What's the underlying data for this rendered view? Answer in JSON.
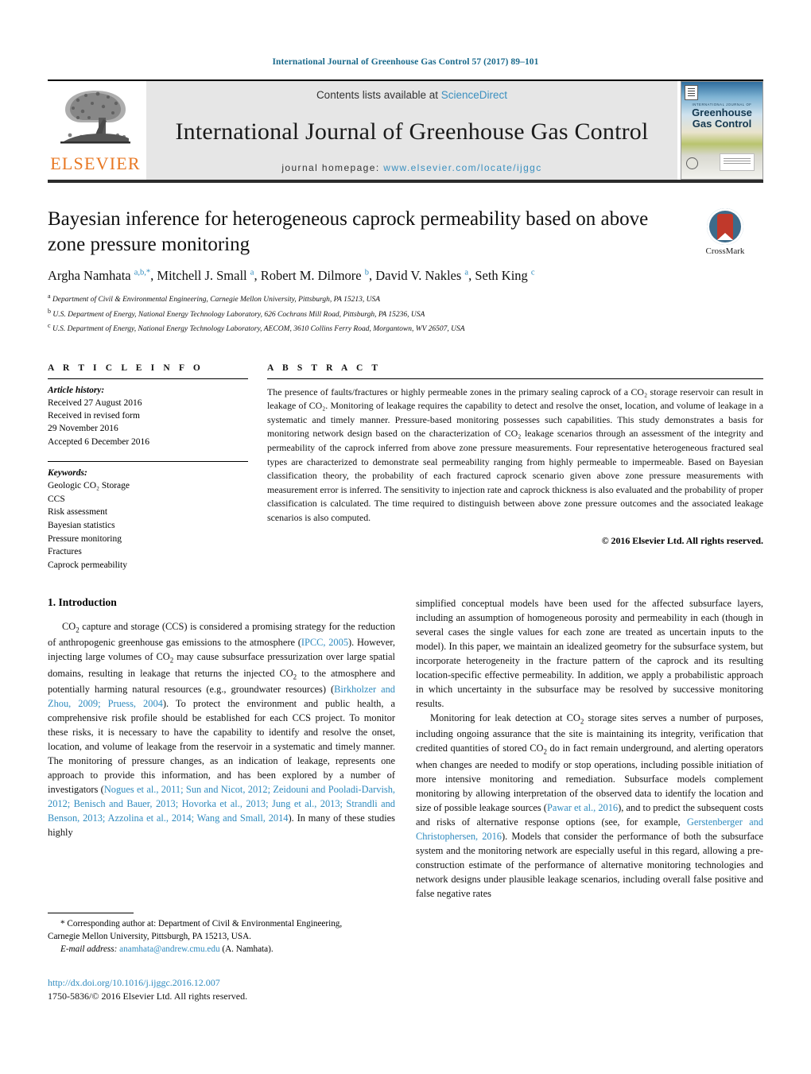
{
  "running_head": "International Journal of Greenhouse Gas Control 57 (2017) 89–101",
  "masthead": {
    "publisher": "ELSEVIER",
    "contents_prefix": "Contents lists available at ",
    "contents_link": "ScienceDirect",
    "journal_title": "International Journal of Greenhouse Gas Control",
    "homepage_prefix": "journal homepage:",
    "homepage_url": "www.elsevier.com/locate/ijggc",
    "cover": {
      "kicker": "INTERNATIONAL JOURNAL OF",
      "title_line1": "Greenhouse",
      "title_line2": "Gas Control"
    },
    "link_color": "#3a8fbf",
    "brand_color": "#E87722"
  },
  "article": {
    "title": "Bayesian inference for heterogeneous caprock permeability based on above zone pressure monitoring",
    "crossmark_label": "CrossMark",
    "authors_html": "Argha Namhata <sup class=\"aff-mark\">a,b,*</sup>, Mitchell J. Small <sup class=\"aff-mark\">a</sup>, Robert M. Dilmore <sup class=\"aff-mark\">b</sup>, David V. Nakles <sup class=\"aff-mark\">a</sup>, Seth King <sup class=\"aff-mark\">c</sup>",
    "affiliations": [
      {
        "mark": "a",
        "text": "Department of Civil & Environmental Engineering, Carnegie Mellon University, Pittsburgh, PA 15213, USA"
      },
      {
        "mark": "b",
        "text": "U.S. Department of Energy, National Energy Technology Laboratory, 626 Cochrans Mill Road, Pittsburgh, PA 15236, USA"
      },
      {
        "mark": "c",
        "text": "U.S. Department of Energy, National Energy Technology Laboratory, AECOM, 3610 Collins Ferry Road, Morgantown, WV 26507, USA"
      }
    ]
  },
  "article_info": {
    "heading": "A R T I C L E   I N F O",
    "history_label": "Article history:",
    "history": [
      "Received 27 August 2016",
      "Received in revised form",
      "29 November 2016",
      "Accepted 6 December 2016"
    ],
    "keywords_label": "Keywords:",
    "keywords": [
      "Geologic CO₂ Storage",
      "CCS",
      "Risk assessment",
      "Bayesian statistics",
      "Pressure monitoring",
      "Fractures",
      "Caprock permeability"
    ]
  },
  "abstract": {
    "heading": "A B S T R A C T",
    "text": "The presence of faults/fractures or highly permeable zones in the primary sealing caprock of a CO₂ storage reservoir can result in leakage of CO₂. Monitoring of leakage requires the capability to detect and resolve the onset, location, and volume of leakage in a systematic and timely manner. Pressure-based monitoring possesses such capabilities. This study demonstrates a basis for monitoring network design based on the characterization of CO₂ leakage scenarios through an assessment of the integrity and permeability of the caprock inferred from above zone pressure measurements. Four representative heterogeneous fractured seal types are characterized to demonstrate seal permeability ranging from highly permeable to impermeable. Based on Bayesian classification theory, the probability of each fractured caprock scenario given above zone pressure measurements with measurement error is inferred. The sensitivity to injection rate and caprock thickness is also evaluated and the probability of proper classification is calculated. The time required to distinguish between above zone pressure outcomes and the associated leakage scenarios is also computed.",
    "copyright": "© 2016 Elsevier Ltd. All rights reserved."
  },
  "body": {
    "section_number_title": "1.  Introduction",
    "left_paragraph_1_html": "CO<sub>2</sub> capture and storage (CCS) is considered a promising strategy for the reduction of anthropogenic greenhouse gas emissions to the atmosphere (<span class=\"ref\">IPCC, 2005</span>). However, injecting large volumes of CO<sub>2</sub> may cause subsurface pressurization over large spatial domains, resulting in leakage that returns the injected CO<sub>2</sub> to the atmosphere and potentially harming natural resources (e.g., groundwater resources) (<span class=\"ref\">Birkholzer and Zhou, 2009; Pruess, 2004</span>). To protect the environment and public health, a comprehensive risk profile should be established for each CCS project. To monitor these risks, it is necessary to have the capability to identify and resolve the onset, location, and volume of leakage from the reservoir in a systematic and timely manner. The monitoring of pressure changes, as an indication of leakage, represents one approach to provide this information, and has been explored by a number of investigators (<span class=\"ref\">Nogues et al., 2011; Sun and Nicot, 2012; Zeidouni and Pooladi-Darvish, 2012; Benisch and Bauer, 2013; Hovorka et al., 2013; Jung et al., 2013; Strandli and Benson, 2013; Azzolina et al., 2014; Wang and Small, 2014</span>). In many of these studies highly",
    "right_paragraph_1_html": "simplified conceptual models have been used for the affected subsurface layers, including an assumption of homogeneous porosity and permeability in each (though in several cases the single values for each zone are treated as uncertain inputs to the model). In this paper, we maintain an idealized geometry for the subsurface system, but incorporate heterogeneity in the fracture pattern of the caprock and its resulting location-specific effective permeability. In addition, we apply a probabilistic approach in which uncertainty in the subsurface may be resolved by successive monitoring results.",
    "right_paragraph_2_html": "Monitoring for leak detection at CO<sub>2</sub> storage sites serves a number of purposes, including ongoing assurance that the site is maintaining its integrity, verification that credited quantities of stored CO<sub>2</sub> do in fact remain underground, and alerting operators when changes are needed to modify or stop operations, including possible initiation of more intensive monitoring and remediation. Subsurface models complement monitoring by allowing interpretation of the observed data to identify the location and size of possible leakage sources (<span class=\"ref\">Pawar et al., 2016</span>), and to predict the subsequent costs and risks of alternative response options (see, for example, <span class=\"ref\">Gerstenberger and Christophersen, 2016</span>). Models that consider the performance of both the subsurface system and the monitoring network are especially useful in this regard, allowing a pre-construction estimate of the performance of alternative monitoring technologies and network designs under plausible leakage scenarios, including overall false positive and false negative rates"
  },
  "footnote": {
    "corresponding_html": "<span class=\"indent\">* Corresponding author at: Department of Civil &amp; Environmental Engineering,</span>Carnegie Mellon University, Pittsburgh, PA 15213, USA.",
    "email_label": "E-mail address:",
    "email": "anamhata@andrew.cmu.edu",
    "email_suffix": "(A. Namhata)."
  },
  "footer": {
    "doi": "http://dx.doi.org/10.1016/j.ijggc.2016.12.007",
    "issn_line": "1750-5836/© 2016 Elsevier Ltd. All rights reserved."
  }
}
